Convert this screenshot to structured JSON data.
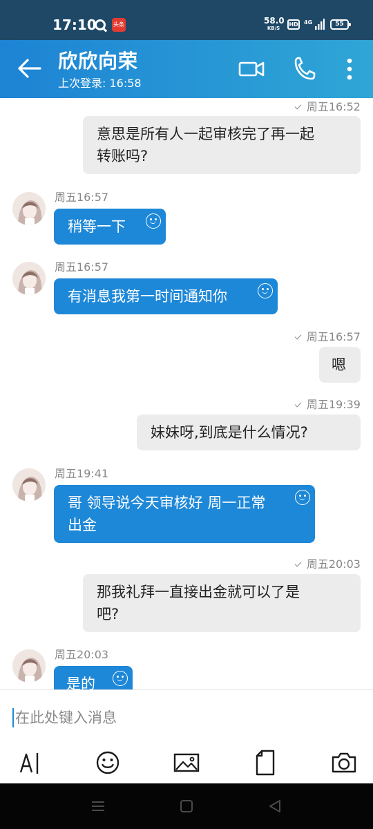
{
  "status_bar": {
    "time": "17:10",
    "news_badge": "头条",
    "speed_value": "58.0",
    "speed_unit": "KB/S",
    "hd": "HD",
    "network": "4G",
    "battery": "55"
  },
  "header": {
    "title": "欣欣向荣",
    "subtitle": "上次登录: 16:58",
    "color_start": "#1d83d4",
    "color_end": "#2fa6d6"
  },
  "messages": [
    {
      "side": "out",
      "time": "周五16:52",
      "line1": "意思是所有人一起审核完了再一起",
      "line2": "转账吗?"
    },
    {
      "side": "in",
      "time": "周五16:57",
      "text": "稍等一下"
    },
    {
      "side": "in",
      "time": "周五16:57",
      "text": "有消息我第一时间通知你"
    },
    {
      "side": "out",
      "time": "周五16:57",
      "text": "嗯"
    },
    {
      "side": "out",
      "time": "周五19:39",
      "text": "妹妹呀,到底是什么情况?"
    },
    {
      "side": "in",
      "time": "周五19:41",
      "line1": "哥 领导说今天审核好 周一正常",
      "line2": "出金"
    },
    {
      "side": "out",
      "time": "周五20:03",
      "line1": "那我礼拜一直接出金就可以了是",
      "line2": "吧?"
    },
    {
      "side": "in",
      "time": "周五20:03",
      "text": "是的"
    }
  ],
  "composer": {
    "placeholder": "在此处键入消息"
  },
  "toolbar_icons": [
    "text-format-icon",
    "emoji-icon",
    "image-icon",
    "file-icon",
    "camera-icon"
  ],
  "colors": {
    "incoming_bubble": "#1e88d8",
    "outgoing_bubble": "#ececec",
    "status_bar": "#1e4866"
  }
}
